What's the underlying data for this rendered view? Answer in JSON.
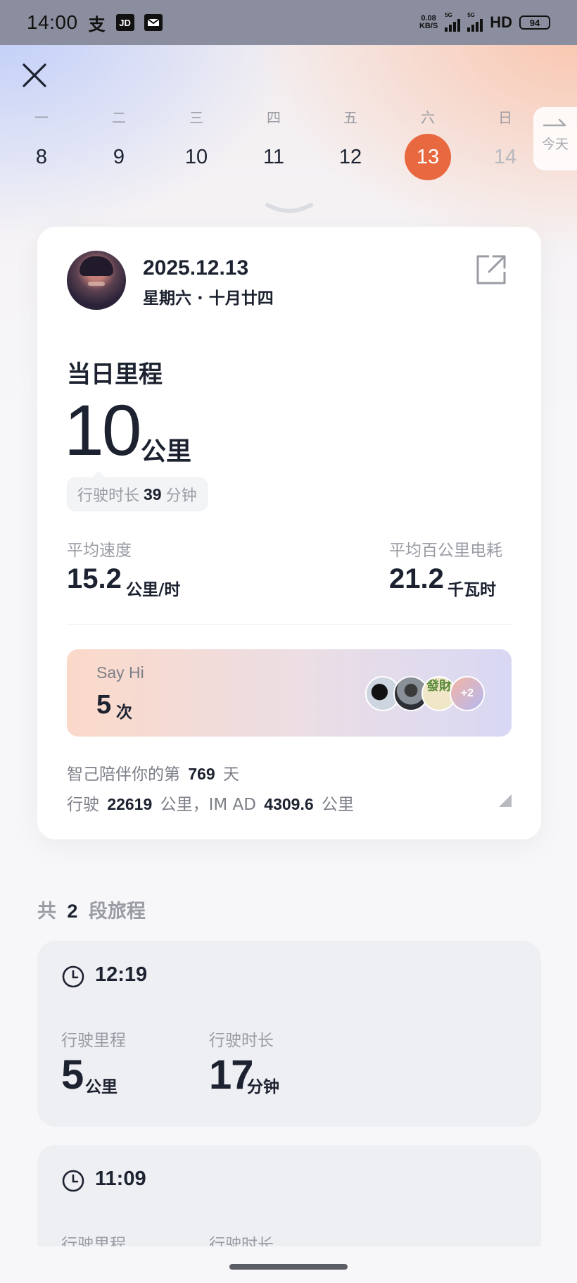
{
  "status_bar": {
    "time": "14:00",
    "app_icons": [
      "alipay-icon",
      "jd-icon",
      "mail-icon"
    ],
    "net_speed_value": "0.08",
    "net_speed_unit": "KB/S",
    "signal_label_1": "5G",
    "signal_label_2": "5G",
    "hd_label": "HD",
    "battery": "94"
  },
  "week": {
    "days": [
      {
        "weekday": "一",
        "date": "8"
      },
      {
        "weekday": "二",
        "date": "9"
      },
      {
        "weekday": "三",
        "date": "10"
      },
      {
        "weekday": "四",
        "date": "11"
      },
      {
        "weekday": "五",
        "date": "12"
      },
      {
        "weekday": "六",
        "date": "13"
      },
      {
        "weekday": "日",
        "date": "14"
      }
    ],
    "selected_date": "13",
    "today_label": "今天",
    "accent_color": "#e8683f"
  },
  "card": {
    "date": "2025.12.13",
    "date_sub": "星期六 · 十月廿四",
    "mileage_title": "当日里程",
    "mileage_value": "10",
    "mileage_unit": "公里",
    "duration_prefix": "行驶时长",
    "duration_value": "39",
    "duration_unit": "分钟",
    "avg_speed_label": "平均速度",
    "avg_speed_value": "15.2",
    "avg_speed_unit": "公里/时",
    "consumption_label": "平均百公里电耗",
    "consumption_value": "21.2",
    "consumption_unit": "千瓦时",
    "sayhi": {
      "label": "Say Hi",
      "count": "5",
      "unit": "次",
      "avatar_3_text": "發財",
      "more_count": "+2"
    },
    "companion_line1_prefix": "智己陪伴你的第",
    "companion_days": "769",
    "companion_line1_suffix": "天",
    "companion_line2_prefix": "行驶",
    "companion_total_km": "22619",
    "companion_line2_mid": "公里，IM AD",
    "companion_imad_km": "4309.6",
    "companion_line2_suffix": "公里"
  },
  "trips": {
    "heading_prefix": "共",
    "count": "2",
    "heading_suffix": "段旅程",
    "items": [
      {
        "time": "12:19",
        "distance_label": "行驶里程",
        "distance_value": "5",
        "distance_unit": "公里",
        "duration_label": "行驶时长",
        "duration_value": "17",
        "duration_unit": "分钟"
      },
      {
        "time": "11:09",
        "distance_label": "行驶里程",
        "duration_label": "行驶时长"
      }
    ]
  }
}
